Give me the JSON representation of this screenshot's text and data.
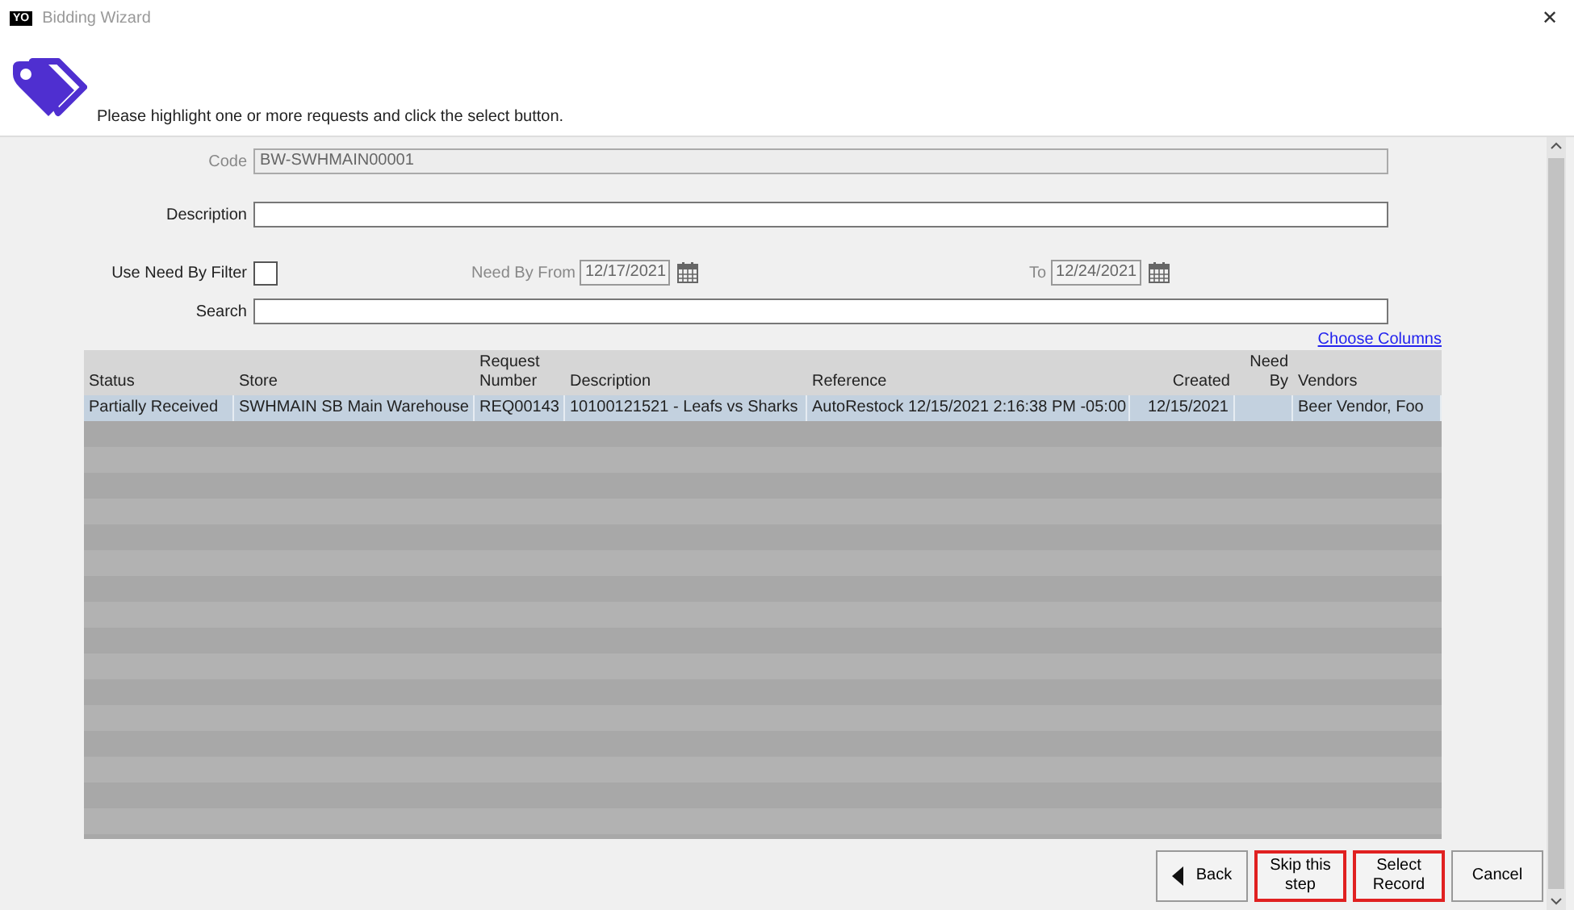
{
  "window": {
    "app_badge": "YO",
    "title": "Bidding Wizard",
    "close": "✕"
  },
  "instruction": "Please highlight one or more requests and click the select button.",
  "form": {
    "code": {
      "label": "Code",
      "value": "BW-SWHMAIN00001",
      "disabled": true
    },
    "description": {
      "label": "Description"
    },
    "need_by_filter": {
      "label": "Use Need By Filter",
      "checked": false
    },
    "need_by_from": {
      "label": "Need By From",
      "value": "12/17/2021"
    },
    "need_by_to": {
      "label": "To",
      "value": "12/24/2021"
    },
    "search": {
      "label": "Search"
    }
  },
  "choose_columns": "Choose Columns",
  "table": {
    "columns": [
      {
        "label": "Status"
      },
      {
        "label": "Store"
      },
      {
        "label": "Request Number"
      },
      {
        "label": "Description"
      },
      {
        "label": "Reference"
      },
      {
        "label": "Created"
      },
      {
        "label": "Need By"
      },
      {
        "label": "Vendors"
      }
    ],
    "rows": [
      {
        "selected": true,
        "cells": [
          "Partially Received",
          "SWHMAIN SB Main Warehouse",
          "REQ00143",
          "10100121521 - Leafs vs Sharks",
          "AutoRestock 12/15/2021 2:16:38 PM -05:00",
          "12/15/2021",
          "",
          "Beer Vendor, Foo"
        ]
      }
    ]
  },
  "buttons": [
    {
      "label": "Back",
      "kind": "back",
      "highlighted": false
    },
    {
      "label": "Skip this step",
      "kind": "plain",
      "highlighted": true
    },
    {
      "label": "Select Record",
      "kind": "plain",
      "highlighted": true
    },
    {
      "label": "Cancel",
      "kind": "plain",
      "highlighted": false
    }
  ]
}
